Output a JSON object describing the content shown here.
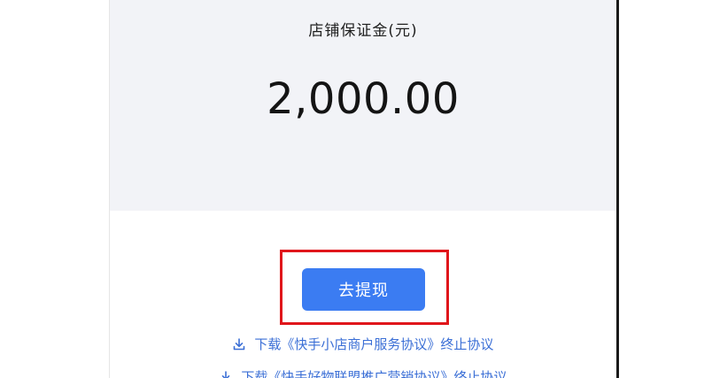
{
  "deposit": {
    "label": "店铺保证金(元)",
    "amount": "2,000.00"
  },
  "actions": {
    "withdraw_label": "去提现"
  },
  "links": [
    {
      "icon": "download-icon",
      "text": "下载《快手小店商户服务协议》终止协议"
    },
    {
      "icon": "download-icon",
      "text": "下载《快手好物联盟推广营销协议》终止协议"
    }
  ],
  "colors": {
    "primary": "#3b7cf2",
    "link": "#3b6fd6",
    "highlight": "#e0161b",
    "card_background": "#f2f3f7"
  }
}
